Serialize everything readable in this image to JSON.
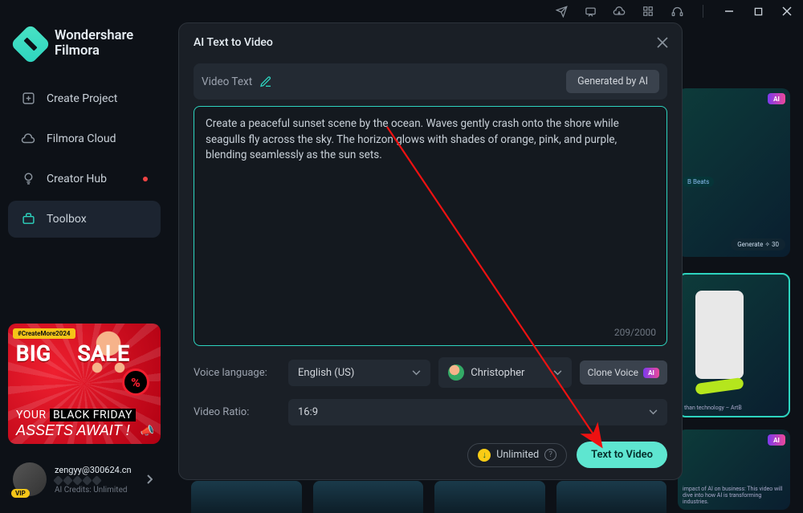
{
  "brand": {
    "line1": "Wondershare",
    "line2": "Filmora"
  },
  "nav": {
    "create": "Create Project",
    "cloud": "Filmora Cloud",
    "creator": "Creator Hub",
    "toolbox": "Toolbox"
  },
  "promo": {
    "tag": "#CreateMore2024",
    "big1": "BIG",
    "big2": "SALE",
    "pct": "%",
    "your": "YOUR",
    "bf": "BLACK FRIDAY",
    "assets": "ASSETS AWAIT !"
  },
  "user": {
    "email": "zengyy@300624.cn",
    "credits": "AI Credits: Unlimited",
    "vip": "VIP"
  },
  "bgcards": {
    "ai": "AI",
    "beats": "B Beats",
    "generate": "Generate ✧ 30",
    "midcap": "than technology – ArtB",
    "botcap": "impact of AI on business: This video will dive into how AI is transforming industries."
  },
  "modal": {
    "title": "AI Text to Video",
    "videoText": "Video Text",
    "generated": "Generated by AI",
    "prompt": "Create a peaceful sunset scene by the ocean. Waves gently crash onto the shore while seagulls fly across the sky. The horizon glows with shades of orange, pink, and purple, blending seamlessly as the sun sets.",
    "counter": "209/2000",
    "voiceLangLabel": "Voice language:",
    "voiceLang": "English (US)",
    "voiceName": "Christopher",
    "clone": "Clone Voice",
    "ratioLabel": "Video Ratio:",
    "ratio": "16:9",
    "unlimited": "Unlimited",
    "cta": "Text to Video",
    "aiBadge": "AI"
  }
}
